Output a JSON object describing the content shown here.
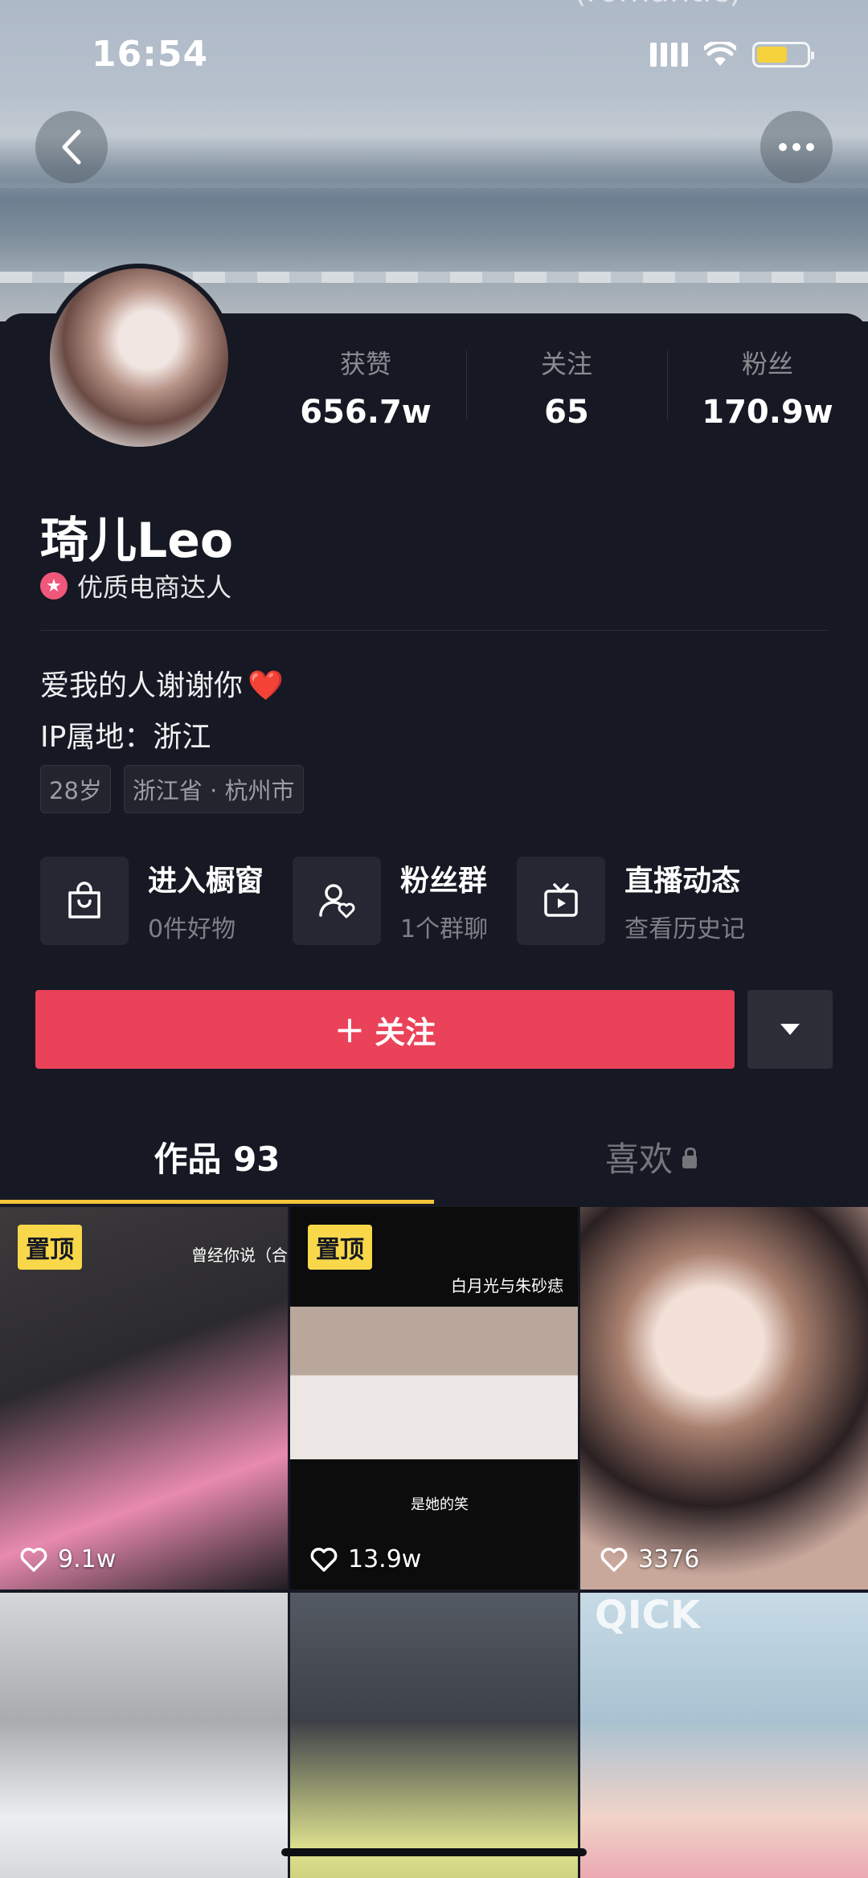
{
  "status_bar": {
    "time": "16:54"
  },
  "cover": {
    "faint_title": "(romantic)"
  },
  "profile": {
    "stats": [
      {
        "label": "获赞",
        "value": "656.7w"
      },
      {
        "label": "关注",
        "value": "65"
      },
      {
        "label": "粉丝",
        "value": "170.9w"
      }
    ],
    "name": "琦儿Leo",
    "badge": "优质电商达人",
    "bio": "爱我的人谢谢你",
    "bio_emoji": "❤️",
    "ip_location": "IP属地：浙江",
    "tags": [
      "28岁",
      "浙江省 · 杭州市"
    ]
  },
  "actions": [
    {
      "title": "进入橱窗",
      "subtitle": "0件好物",
      "icon": "shopping-bag-icon"
    },
    {
      "title": "粉丝群",
      "subtitle": "1个群聊",
      "icon": "fan-group-icon"
    },
    {
      "title": "直播动态",
      "subtitle": "查看历史记",
      "icon": "live-tv-icon"
    }
  ],
  "follow": {
    "label": "关注",
    "plus": "+"
  },
  "tabs": [
    {
      "label": "作品 93"
    },
    {
      "label": "喜欢"
    }
  ],
  "videos": [
    {
      "pinned": "置顶",
      "likes": "9.1w",
      "overlay": "曾经你说（合"
    },
    {
      "pinned": "置顶",
      "likes": "13.9w",
      "overlay": "白月光与朱砂痣",
      "overlay2": "是她的笑"
    },
    {
      "likes": "3376"
    },
    {},
    {},
    {
      "overlay": "QICK"
    }
  ],
  "colors": {
    "accent": "#ea4259",
    "tab_indicator": "#f4c53a",
    "pin": "#f8d84a",
    "background": "#161823"
  }
}
